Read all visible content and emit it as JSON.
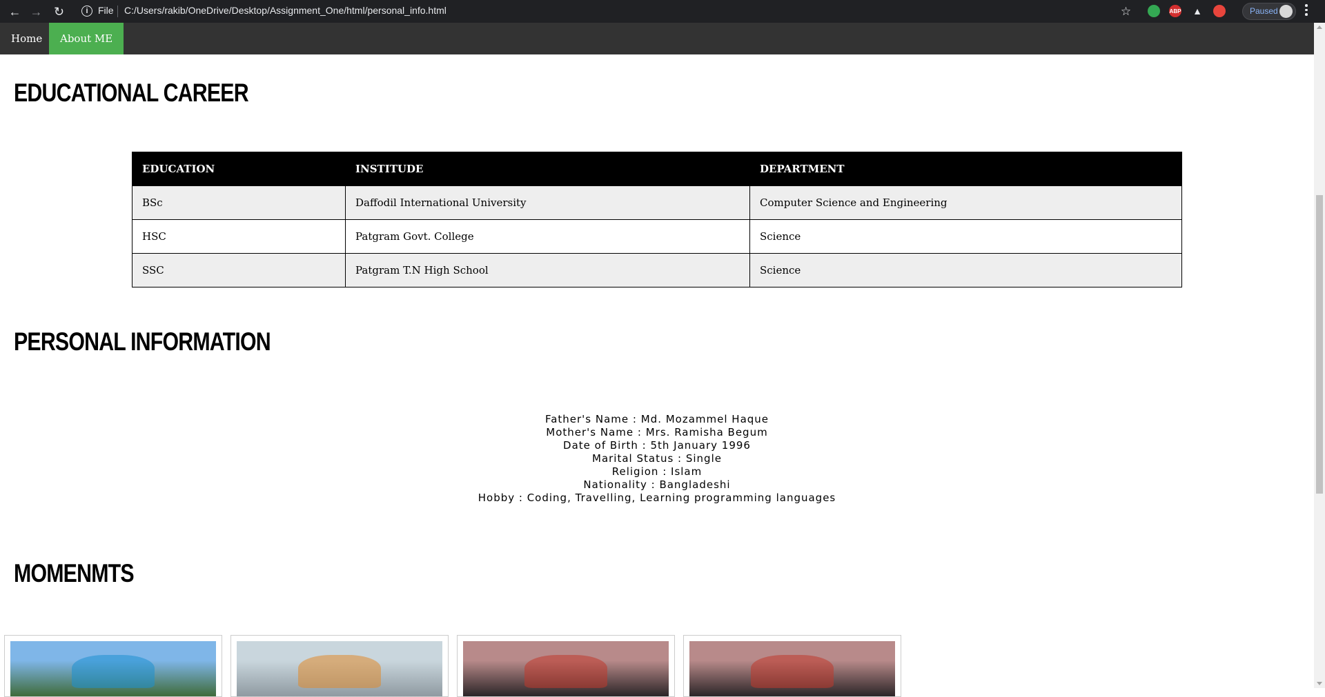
{
  "browser": {
    "nav": {
      "back": "←",
      "forward": "→",
      "reload": "↻"
    },
    "address": {
      "info_icon": "i",
      "scheme_label": "File",
      "url": "C:/Users/rakib/OneDrive/Desktop/Assignment_One/html/personal_info.html"
    },
    "bookmark_icon": "☆",
    "extensions": [
      {
        "name": "color-extension-icon",
        "label": "",
        "color": "#34a853"
      },
      {
        "name": "adblock-plus-icon",
        "label": "ABP",
        "color": "#d32f2f"
      },
      {
        "name": "triangle-extension-icon",
        "label": "▲",
        "color": "#202124"
      },
      {
        "name": "record-extension-icon",
        "label": "",
        "color": "#e8453c"
      }
    ],
    "profile": {
      "status": "Paused"
    }
  },
  "nav": {
    "items": [
      {
        "label": "Home",
        "active": false
      },
      {
        "label": "About ME",
        "active": true
      }
    ],
    "accent": "#4caf50",
    "bar_color": "#333333"
  },
  "education": {
    "heading": "EDUCATIONAL CAREER",
    "columns": [
      "EDUCATION",
      "INSTITUDE",
      "DEPARTMENT"
    ],
    "rows": [
      [
        "BSc",
        "Daffodil International University",
        "Computer Science and Engineering"
      ],
      [
        "HSC",
        "Patgram Govt. College",
        "Science"
      ],
      [
        "SSC",
        "Patgram T.N High School",
        "Science"
      ]
    ]
  },
  "personal": {
    "heading": "PERSONAL INFORMATION",
    "lines": [
      "Father's Name : Md. Mozammel Haque",
      "Mother's Name : Mrs. Ramisha Begum",
      "Date of Birth : 5th January 1996",
      "Marital Status : Single",
      "Religion : Islam",
      "Nationality : Bangladeshi",
      "Hobby : Coding, Travelling, Learning programming languages"
    ]
  },
  "moments": {
    "heading": "MOMENMTS",
    "photos": [
      {
        "name": "group-photo-campus",
        "sky": "#7fb6e8",
        "ground": "#3f6b3a",
        "accent": "#1e8fd0"
      },
      {
        "name": "group-photo-building",
        "sky": "#c9d6dd",
        "ground": "#8f9aa1",
        "accent": "#e08a2c"
      },
      {
        "name": "party-photo-1",
        "sky": "#b88a8a",
        "ground": "#2b2527",
        "accent": "#c0392b"
      },
      {
        "name": "party-photo-2",
        "sky": "#b88a8a",
        "ground": "#2b2527",
        "accent": "#c0392b"
      }
    ]
  }
}
